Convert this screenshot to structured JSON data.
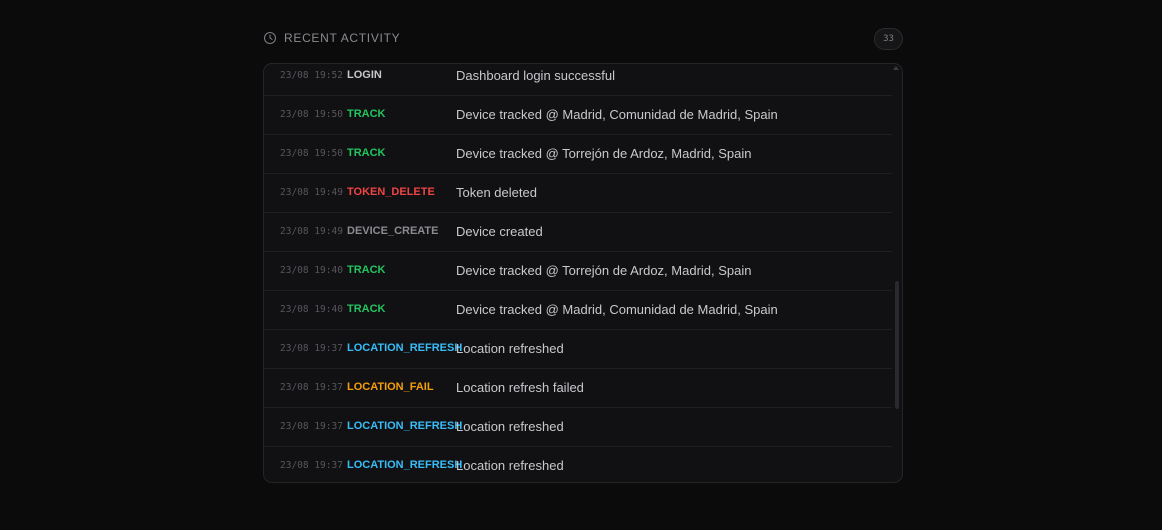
{
  "header": {
    "title": "RECENT ACTIVITY",
    "count": "33"
  },
  "colors": {
    "default_type": "#c8c8cc",
    "track": "#22c55e",
    "token_delete": "#ef4444",
    "device_create": "#8b8b90",
    "location_refresh": "#38bdf8",
    "location_fail": "#f59e0b"
  },
  "activity": [
    {
      "time": "23/08 19:52",
      "type": "LOGIN",
      "message": "Dashboard login successful",
      "color": "#c8c8cc"
    },
    {
      "time": "23/08 19:50",
      "type": "TRACK",
      "message": "Device tracked @ Madrid, Comunidad de Madrid, Spain",
      "color": "#22c55e"
    },
    {
      "time": "23/08 19:50",
      "type": "TRACK",
      "message": "Device tracked @ Torrejón de Ardoz, Madrid, Spain",
      "color": "#22c55e"
    },
    {
      "time": "23/08 19:49",
      "type": "TOKEN_DELETE",
      "message": "Token deleted",
      "color": "#ef4444"
    },
    {
      "time": "23/08 19:49",
      "type": "DEVICE_CREATE",
      "message": "Device created",
      "color": "#8b8b90"
    },
    {
      "time": "23/08 19:40",
      "type": "TRACK",
      "message": "Device tracked @ Torrejón de Ardoz, Madrid, Spain",
      "color": "#22c55e"
    },
    {
      "time": "23/08 19:40",
      "type": "TRACK",
      "message": "Device tracked @ Madrid, Comunidad de Madrid, Spain",
      "color": "#22c55e"
    },
    {
      "time": "23/08 19:37",
      "type": "LOCATION_REFRESH",
      "message": "Location refreshed",
      "color": "#38bdf8"
    },
    {
      "time": "23/08 19:37",
      "type": "LOCATION_FAIL",
      "message": "Location refresh failed",
      "color": "#f59e0b"
    },
    {
      "time": "23/08 19:37",
      "type": "LOCATION_REFRESH",
      "message": "Location refreshed",
      "color": "#38bdf8"
    },
    {
      "time": "23/08 19:37",
      "type": "LOCATION_REFRESH",
      "message": "Location refreshed",
      "color": "#38bdf8"
    }
  ]
}
